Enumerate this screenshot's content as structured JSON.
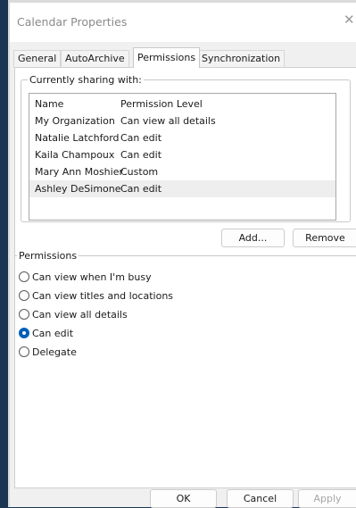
{
  "window": {
    "title": "Calendar Properties",
    "close_glyph": "✕"
  },
  "tabs": [
    {
      "label": "General",
      "active": false
    },
    {
      "label": "AutoArchive",
      "active": false
    },
    {
      "label": "Permissions",
      "active": true
    },
    {
      "label": "Synchronization",
      "active": false
    }
  ],
  "sharing": {
    "legend": "Currently sharing with:",
    "columns": {
      "name": "Name",
      "permission": "Permission Level"
    },
    "rows": [
      {
        "name": "My Organization",
        "permission": "Can view all details",
        "selected": false
      },
      {
        "name": "Natalie Latchford",
        "permission": "Can edit",
        "selected": false
      },
      {
        "name": "Kaila Champoux",
        "permission": "Can edit",
        "selected": false
      },
      {
        "name": "Mary Ann Moshier",
        "permission": "Custom",
        "selected": false
      },
      {
        "name": "Ashley DeSimone",
        "permission": "Can edit",
        "selected": true
      }
    ],
    "add_label": "Add...",
    "remove_label": "Remove"
  },
  "permissions": {
    "legend": "Permissions",
    "options": [
      {
        "label": "Can view when I'm busy",
        "checked": false
      },
      {
        "label": "Can view titles and locations",
        "checked": false
      },
      {
        "label": "Can view all details",
        "checked": false
      },
      {
        "label": "Can edit",
        "checked": true
      },
      {
        "label": "Delegate",
        "checked": false
      }
    ]
  },
  "footer": {
    "ok_label": "OK",
    "cancel_label": "Cancel",
    "apply_label": "Apply",
    "apply_enabled": false
  },
  "colors": {
    "accent": "#005fb8",
    "background": "#1c3553",
    "selection": "#eeeeee"
  }
}
